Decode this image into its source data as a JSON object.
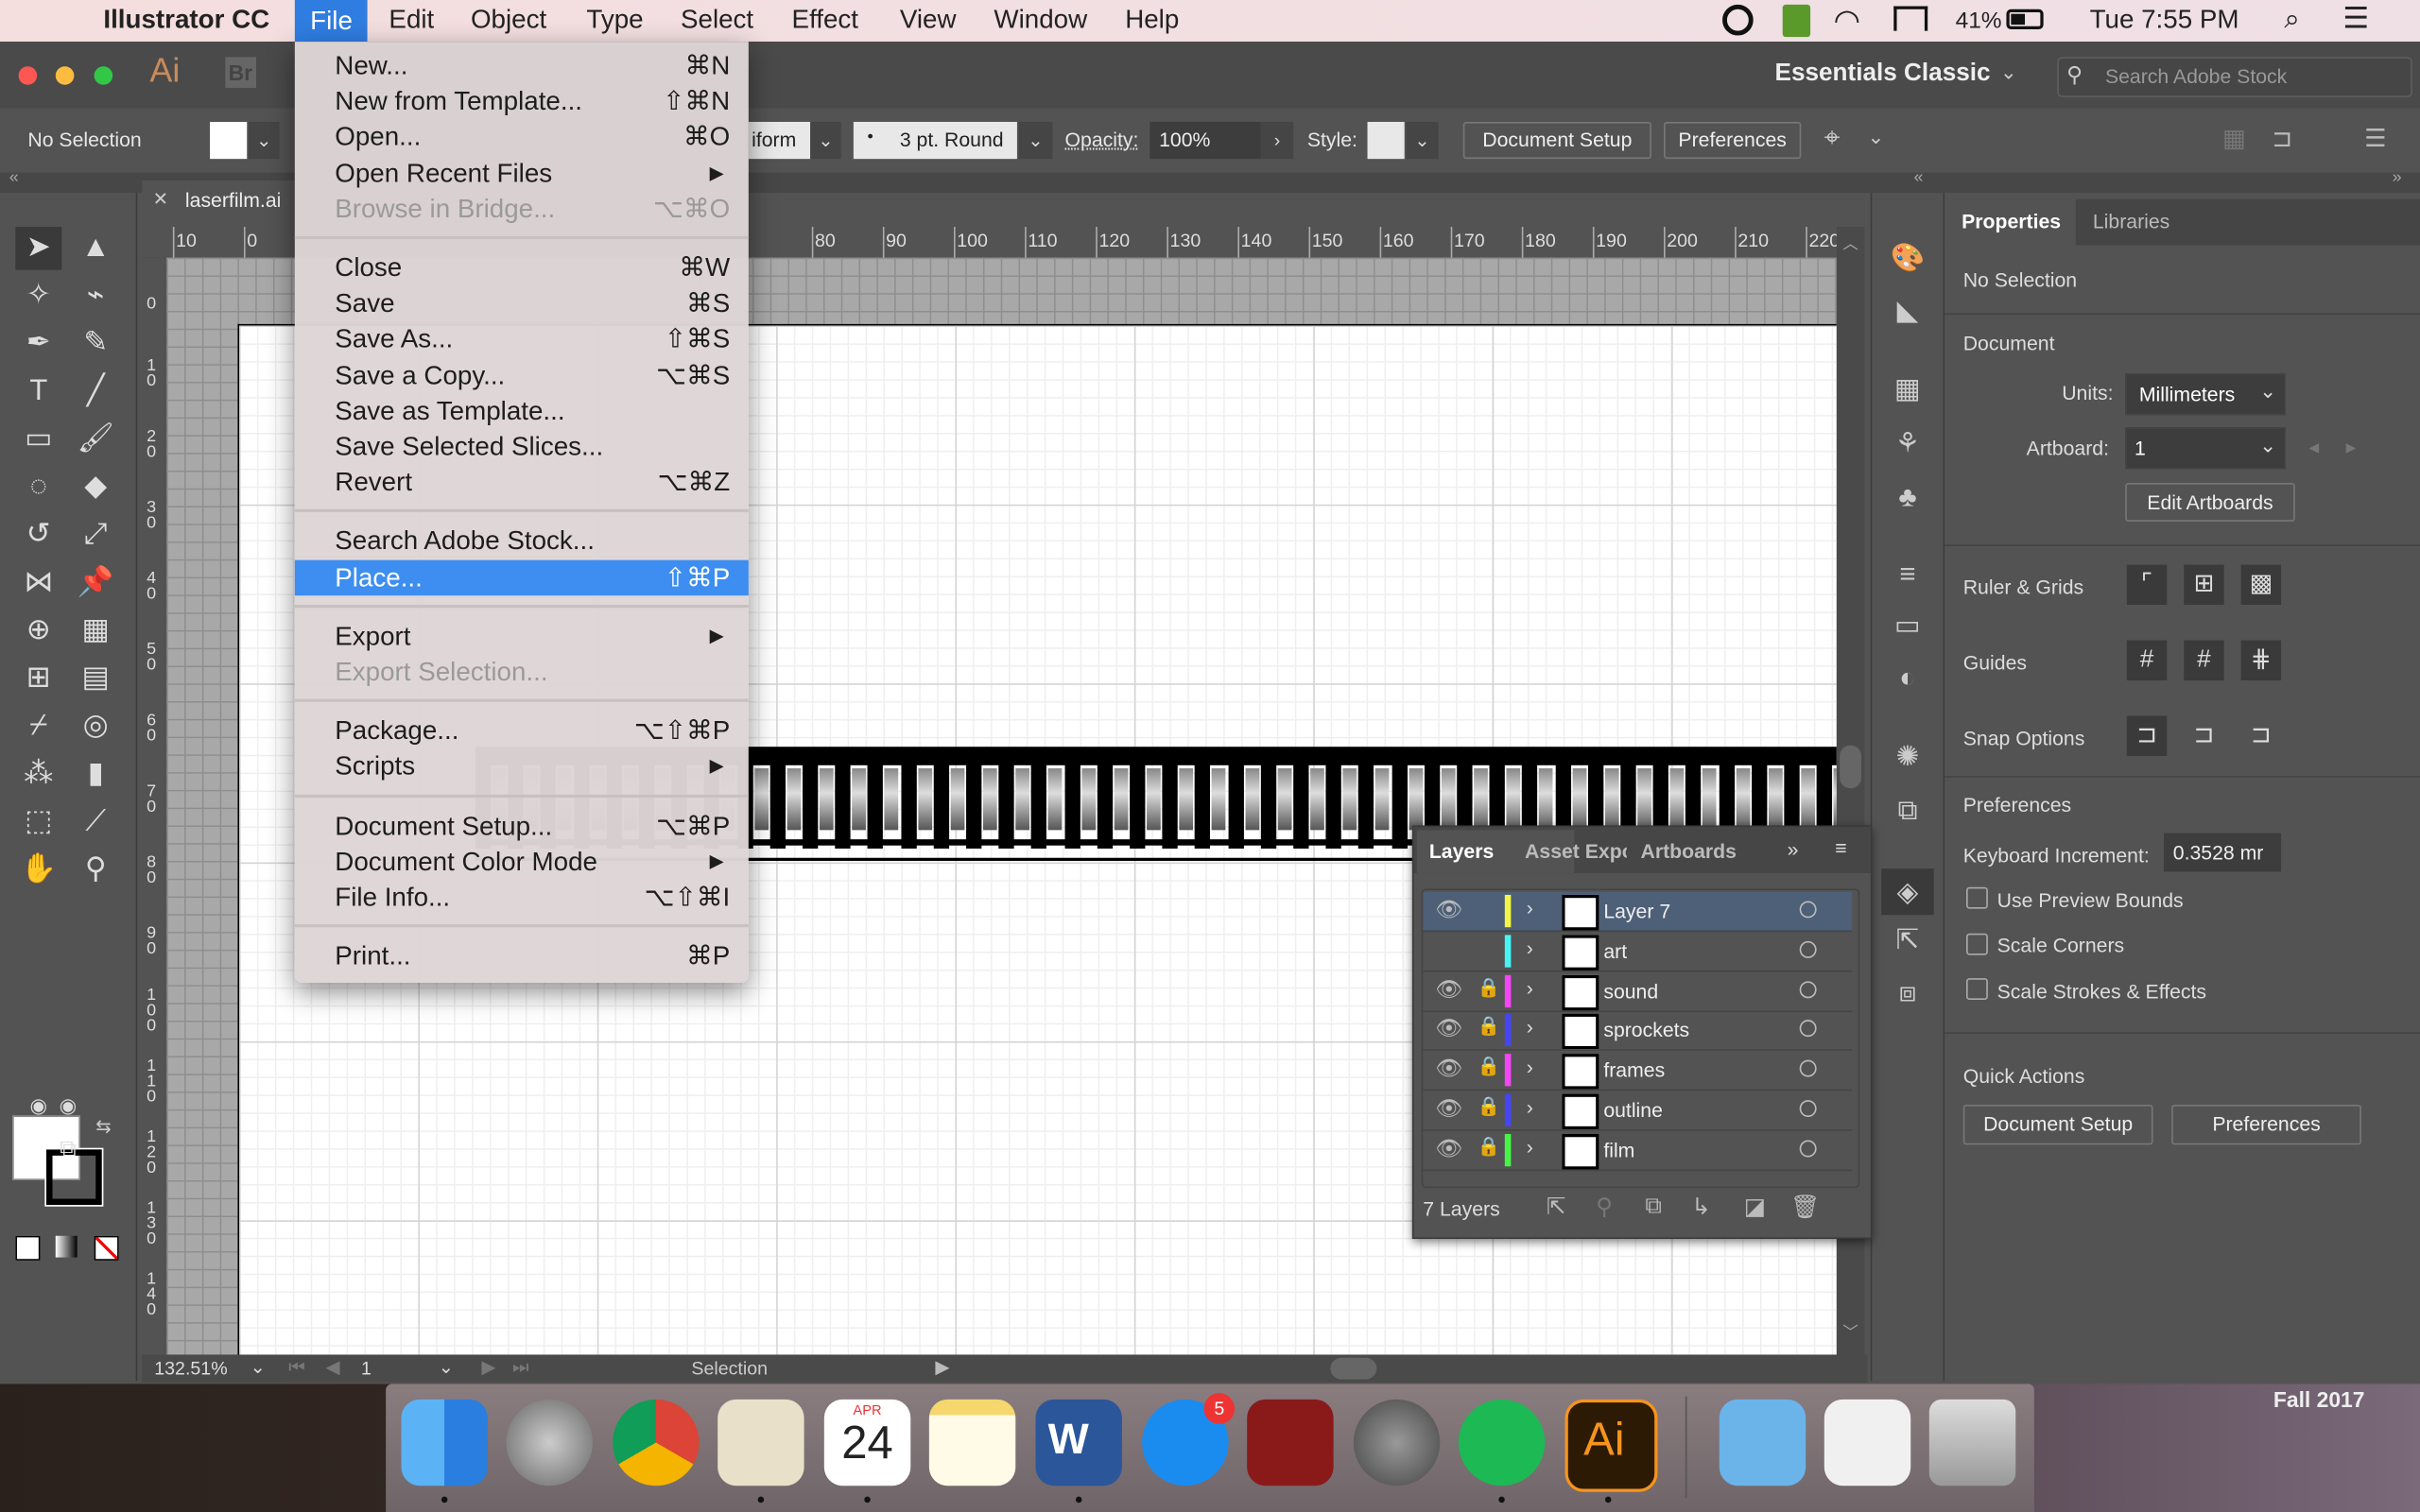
{
  "menubar": {
    "app_name": "Illustrator CC",
    "items": [
      "File",
      "Edit",
      "Object",
      "Type",
      "Select",
      "Effect",
      "View",
      "Window",
      "Help"
    ],
    "active": "File",
    "battery": "41%",
    "clock": "Tue 7:55 PM"
  },
  "titlebar": {
    "ai_logo": "Ai",
    "br_logo": "Br",
    "workspace": "Essentials Classic",
    "search_placeholder": "Search Adobe Stock"
  },
  "control_bar": {
    "selection": "No Selection",
    "profile": "iform",
    "brush": "3 pt. Round",
    "opacity_label": "Opacity:",
    "opacity_value": "100%",
    "style_label": "Style:",
    "document_setup": "Document Setup",
    "preferences": "Preferences"
  },
  "document": {
    "tab": "laserfilm.ai",
    "close": "✕"
  },
  "rulers": {
    "top": [
      "10",
      "0",
      "80",
      "90",
      "100",
      "110",
      "120",
      "130",
      "140",
      "150",
      "160",
      "170",
      "180",
      "190",
      "200",
      "210",
      "220"
    ],
    "left": [
      "0",
      "10",
      "20",
      "30",
      "40",
      "50",
      "60",
      "70",
      "80",
      "90",
      "100",
      "110",
      "120",
      "130",
      "140"
    ]
  },
  "status_bar": {
    "zoom": "132.51%",
    "artboard": "1",
    "tool": "Selection"
  },
  "file_menu": [
    {
      "label": "New...",
      "shortcut": "⌘N"
    },
    {
      "label": "New from Template...",
      "shortcut": "⇧⌘N"
    },
    {
      "label": "Open...",
      "shortcut": "⌘O"
    },
    {
      "label": "Open Recent Files",
      "shortcut": "▶"
    },
    {
      "label": "Browse in Bridge...",
      "shortcut": "⌥⌘O",
      "disabled": true
    },
    {
      "sep": true
    },
    {
      "label": "Close",
      "shortcut": "⌘W"
    },
    {
      "label": "Save",
      "shortcut": "⌘S"
    },
    {
      "label": "Save As...",
      "shortcut": "⇧⌘S"
    },
    {
      "label": "Save a Copy...",
      "shortcut": "⌥⌘S"
    },
    {
      "label": "Save as Template...",
      "shortcut": ""
    },
    {
      "label": "Save Selected Slices...",
      "shortcut": ""
    },
    {
      "label": "Revert",
      "shortcut": "⌥⌘Z"
    },
    {
      "sep": true
    },
    {
      "label": "Search Adobe Stock...",
      "shortcut": ""
    },
    {
      "label": "Place...",
      "shortcut": "⇧⌘P",
      "highlighted": true
    },
    {
      "sep": true
    },
    {
      "label": "Export",
      "shortcut": "▶"
    },
    {
      "label": "Export Selection...",
      "shortcut": "",
      "disabled": true
    },
    {
      "sep": true
    },
    {
      "label": "Package...",
      "shortcut": "⌥⇧⌘P"
    },
    {
      "label": "Scripts",
      "shortcut": "▶"
    },
    {
      "sep": true
    },
    {
      "label": "Document Setup...",
      "shortcut": "⌥⌘P"
    },
    {
      "label": "Document Color Mode",
      "shortcut": "▶"
    },
    {
      "label": "File Info...",
      "shortcut": "⌥⇧⌘I"
    },
    {
      "sep": true
    },
    {
      "label": "Print...",
      "shortcut": "⌘P"
    }
  ],
  "layers_panel": {
    "tabs": [
      "Layers",
      "Asset Expo",
      "Artboards"
    ],
    "layers": [
      {
        "name": "Layer 7",
        "color": "#f5f545",
        "visible": true,
        "locked": false,
        "selected": true
      },
      {
        "name": "art",
        "color": "#45f5f5",
        "visible": false,
        "locked": false
      },
      {
        "name": "sound",
        "color": "#f545f5",
        "visible": true,
        "locked": true
      },
      {
        "name": "sprockets",
        "color": "#4545f5",
        "visible": true,
        "locked": true
      },
      {
        "name": "frames",
        "color": "#f545f5",
        "visible": true,
        "locked": true
      },
      {
        "name": "outline",
        "color": "#4545f5",
        "visible": true,
        "locked": true
      },
      {
        "name": "film",
        "color": "#45f545",
        "visible": true,
        "locked": true
      }
    ],
    "count": "7 Layers"
  },
  "properties": {
    "tabs": [
      "Properties",
      "Libraries"
    ],
    "selection": "No Selection",
    "document_heading": "Document",
    "units_label": "Units:",
    "units_value": "Millimeters",
    "artboard_label": "Artboard:",
    "artboard_value": "1",
    "edit_artboards": "Edit Artboards",
    "ruler_grids": "Ruler & Grids",
    "guides": "Guides",
    "snap_options": "Snap Options",
    "preferences_heading": "Preferences",
    "keyboard_increment_label": "Keyboard Increment:",
    "keyboard_increment_value": "0.3528 mr",
    "use_preview_bounds": "Use Preview Bounds",
    "scale_corners": "Scale Corners",
    "scale_strokes": "Scale Strokes & Effects",
    "quick_actions": "Quick Actions",
    "document_setup": "Document Setup",
    "preferences": "Preferences"
  },
  "dock": {
    "apps": [
      "finder",
      "launchpad",
      "chrome",
      "mail",
      "calendar",
      "notes",
      "word",
      "app-store",
      "photo-booth",
      "system-preferences",
      "spotify",
      "illustrator",
      "downloads",
      "document",
      "trash"
    ],
    "calendar_month": "APR",
    "calendar_day": "24",
    "app_store_badge": "5",
    "illustrator_label": "Ai",
    "word_label": "W"
  },
  "desktop_label": "Fall 2017"
}
